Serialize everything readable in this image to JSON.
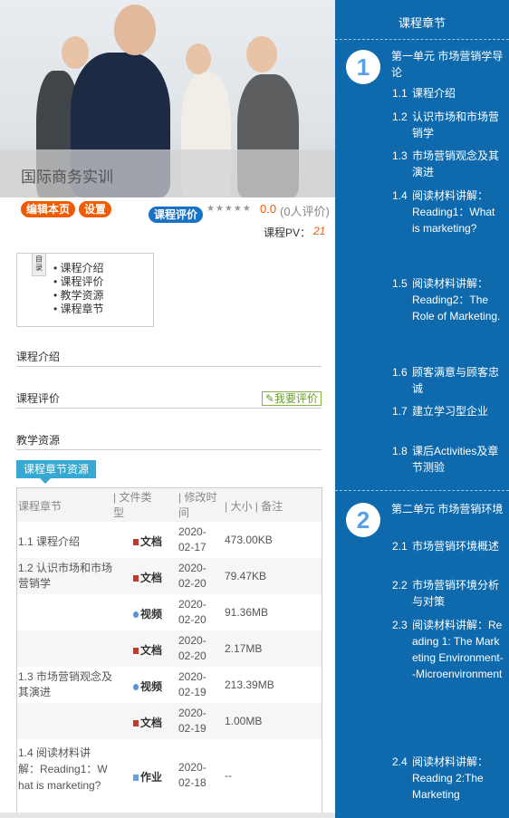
{
  "course": {
    "title": "国际商务实训"
  },
  "actions": {
    "edit_label": "编辑本页",
    "settings_label": "设置",
    "review_label": "课程评价"
  },
  "rating": {
    "stars": "★★★★★",
    "score": "0.0",
    "count_text": "(0人评价)",
    "pv_label": "课程PV：",
    "pv_value": "21"
  },
  "toc": {
    "tag": "目录",
    "items": [
      "课程介绍",
      "课程评价",
      "教学资源",
      "课程章节"
    ]
  },
  "sections": {
    "intro": "课程介绍",
    "review": "课程评价",
    "review_button": "我要评价",
    "resources": "教学资源",
    "resource_tab": "课程章节资源"
  },
  "table": {
    "headers": {
      "chapter": "课程章节",
      "type": "| 文件类型",
      "modified": "| 修改时间",
      "size": "| 大小 | 备注"
    },
    "rows": [
      {
        "chapter": "1.1 课程介绍",
        "type": "文档",
        "date": "2020-02-17",
        "size": "473.00KB"
      },
      {
        "chapter": "1.2 认识市场和市场营销学",
        "type": "文档",
        "date": "2020-02-20",
        "size": "79.47KB"
      },
      {
        "chapter": "",
        "type": "视频",
        "date": "2020-02-20",
        "size": "91.36MB"
      },
      {
        "chapter": "",
        "type": "文档",
        "date": "2020-02-20",
        "size": "2.17MB"
      },
      {
        "chapter": "1.3 市场营销观念及其演进",
        "type": "视频",
        "date": "2020-02-19",
        "size": "213.39MB"
      },
      {
        "chapter": "",
        "type": "文档",
        "date": "2020-02-19",
        "size": "1.00MB"
      },
      {
        "chapter": "1.4 阅读材料讲解：Reading1：What is marketing?",
        "type": "作业",
        "date": "2020-02-18",
        "size": "--"
      }
    ]
  },
  "sidebar": {
    "title": "课程章节",
    "units": [
      {
        "number": "1",
        "title": "第一单元 市场营销学导论",
        "lessons": [
          {
            "num": "1.1",
            "title": "课程介绍"
          },
          {
            "num": "1.2",
            "title": "认识市场和市场营销学"
          },
          {
            "num": "1.3",
            "title": "市场营销观念及其演进"
          },
          {
            "num": "1.4",
            "title": "阅读材料讲解：Reading1：What is marketing?"
          },
          {
            "num": "1.5",
            "title": "阅读材料讲解：Reading2：The Role of Marketing."
          },
          {
            "num": "1.6",
            "title": "顾客满意与顾客忠诚"
          },
          {
            "num": "1.7",
            "title": "建立学习型企业"
          },
          {
            "num": "1.8",
            "title": "课后Activities及章节测验"
          }
        ]
      },
      {
        "number": "2",
        "title": "第二单元 市场营销环境",
        "lessons": [
          {
            "num": "2.1",
            "title": "市场营销环境概述"
          },
          {
            "num": "2.2",
            "title": "市场营销环境分析与对策"
          },
          {
            "num": "2.3",
            "title": "阅读材料讲解：Reading 1: The Marketing Environment--Microenvironment"
          },
          {
            "num": "2.4",
            "title": "阅读材料讲解：Reading 2:The Marketing"
          }
        ]
      }
    ]
  },
  "colors": {
    "accent_orange": "#f05a00",
    "accent_blue": "#1a72c7",
    "sidebar_bg": "#0e6aad",
    "tab_cyan": "#35a9d1"
  }
}
